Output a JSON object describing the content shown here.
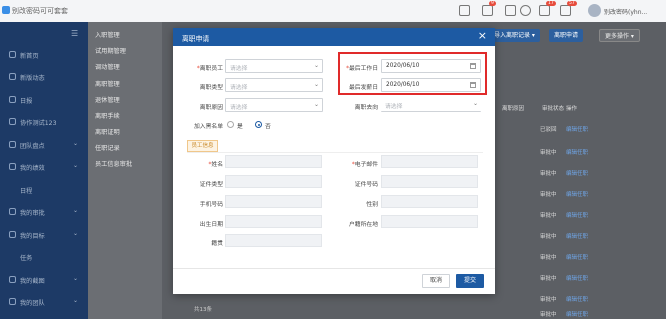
{
  "topbar": {
    "title": "别改密码可可套套",
    "badge1": "9",
    "badge2": "17",
    "badge3": "57",
    "username": "别改密码(yhn..."
  },
  "sidebar": {
    "items": [
      {
        "label": "新首页"
      },
      {
        "label": "新版动态"
      },
      {
        "label": "日报"
      },
      {
        "label": "协作测试123"
      },
      {
        "label": "团队盘点"
      },
      {
        "label": "我的绩效"
      },
      {
        "label": "日程"
      },
      {
        "label": "我的审批"
      },
      {
        "label": "我的目标"
      },
      {
        "label": "任务"
      },
      {
        "label": "我的截图"
      },
      {
        "label": "我的团队"
      }
    ]
  },
  "subnav": {
    "items": [
      "入职管理",
      "试用期管理",
      "调动管理",
      "离职管理",
      "退休管理",
      "离职手续",
      "离职证明",
      "任职记录",
      "员工信息审批"
    ]
  },
  "toolbar": {
    "import_label": "导入离职记录 ▾",
    "apply_label": "离职申请",
    "more_label": "更多操作 ▾"
  },
  "table": {
    "headers": [
      "离职原因",
      "审批状态",
      "操作"
    ],
    "rows": [
      {
        "status": "已驳回",
        "op": "编辑任职"
      },
      {
        "status": "审批中",
        "op": "编辑任职"
      },
      {
        "status": "审批中",
        "op": "编辑任职"
      },
      {
        "status": "审批中",
        "op": "编辑任职"
      },
      {
        "status": "审批中",
        "op": "编辑任职"
      },
      {
        "status": "审批中",
        "op": "编辑任职"
      },
      {
        "status": "审批中",
        "op": "编辑任职"
      },
      {
        "status": "审批中",
        "op": "编辑任职"
      },
      {
        "status": "审批中",
        "op": "编辑任职"
      },
      {
        "status": "审批中",
        "op": "编辑任职"
      }
    ],
    "pager": "共13条"
  },
  "modal": {
    "title": "离职申请",
    "close": "×",
    "fields": {
      "employee": {
        "label": "离职员工",
        "placeholder": "请选择"
      },
      "last_workday": {
        "label": "最后工作日",
        "value": "2020/06/10"
      },
      "type": {
        "label": "离职类型",
        "placeholder": "请选择"
      },
      "last_payday": {
        "label": "最后发薪日",
        "value": "2020/06/10"
      },
      "reason": {
        "label": "离职原因",
        "placeholder": "请选择"
      },
      "destination": {
        "label": "离职去向",
        "placeholder": "请选择"
      },
      "blacklist": {
        "label": "加入黑名单",
        "yes": "是",
        "no": "否",
        "selected": "否"
      }
    },
    "section": "员工信息",
    "info": {
      "name": "姓名",
      "email": "电子邮件",
      "id_type": "证件类型",
      "id_no": "证件号码",
      "phone": "手机号码",
      "gender": "性别",
      "birthday": "出生日期",
      "domicile": "户籍所在地",
      "native": "籍贯"
    },
    "cancel_label": "取消",
    "submit_label": "提交"
  },
  "colors": {
    "primary": "#1d5aa3",
    "highlight": "#e02a2a",
    "sidebar": "#1d3a66"
  }
}
